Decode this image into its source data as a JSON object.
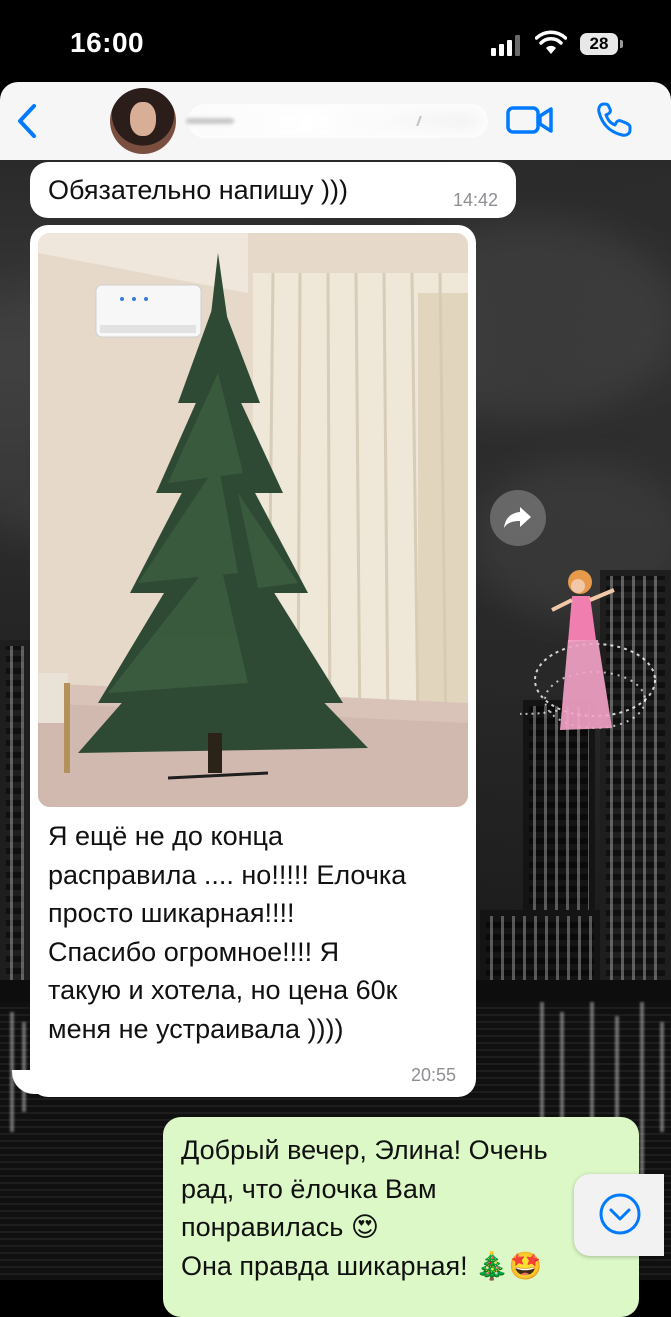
{
  "status_bar": {
    "time": "16:00",
    "battery": "28"
  },
  "header": {
    "contact_name": "",
    "back_icon": "chevron-left-icon",
    "video_icon": "video-camera-icon",
    "call_icon": "phone-icon"
  },
  "messages": [
    {
      "direction": "incoming",
      "text": "Обязательно напишу )))",
      "time": "14:42"
    },
    {
      "direction": "incoming",
      "has_photo": true,
      "text": "Я ещё не до конца\nрасправила .... но!!!!! Елочка\nпросто шикарная!!!!\nСпасибо огромное!!!! Я\nтакую и хотела, но цена 60к\nменя не устраивала ))))",
      "time": "20:55"
    },
    {
      "direction": "outgoing",
      "text": "Добрый вечер, Элина! Очень\nрад, что ёлочка Вам\nпонравилась 😍\nОна правда шикарная! 🎄🤩"
    }
  ],
  "colors": {
    "ios_blue": "#007aff",
    "incoming_bubble": "#ffffff",
    "outgoing_bubble": "#dcf8c6",
    "timestamp": "#8e8e93"
  }
}
